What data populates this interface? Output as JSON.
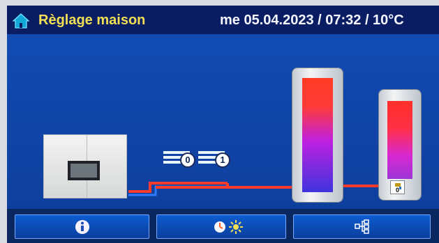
{
  "header": {
    "title": "Règlage maison",
    "status": "me 05.04.2023 / 07:32 /  10°C",
    "icon": "home-icon"
  },
  "fans": [
    {
      "level": "0",
      "icon": "fan-lines-icon"
    },
    {
      "level": "1",
      "icon": "fan-lines-icon"
    }
  ],
  "hot_water": {
    "tap_value": "0",
    "icon": "tap-icon"
  },
  "buttons": [
    {
      "name": "info-button",
      "icon": "info-icon"
    },
    {
      "name": "mode-button",
      "icon": "moon-clock-sun-icon"
    },
    {
      "name": "network-button",
      "icon": "network-tree-icon"
    }
  ],
  "colors": {
    "background": "#0f3f9e",
    "topbar": "#0a1d63",
    "title": "#f2df53",
    "pipe_hot": "#ff3b2a",
    "pipe_return": "#2f7bff"
  }
}
